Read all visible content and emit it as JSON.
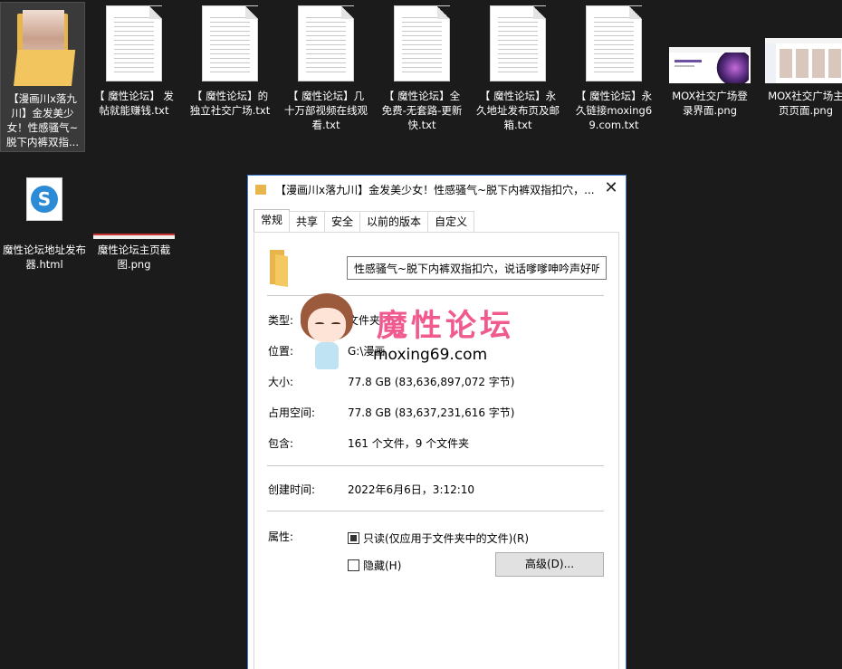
{
  "files": [
    {
      "name": "【漫画川x落九川】金发美少女！性感骚气~脱下内裤双指...",
      "type": "folder",
      "selected": true
    },
    {
      "name": "【 魔性论坛】 发帖就能赚钱.txt",
      "type": "txt"
    },
    {
      "name": "【 魔性论坛】的独立社交广场.txt",
      "type": "txt"
    },
    {
      "name": "【 魔性论坛】几十万部视频在线观看.txt",
      "type": "txt"
    },
    {
      "name": "【 魔性论坛】全免费-无套路-更新快.txt",
      "type": "txt"
    },
    {
      "name": "【 魔性论坛】永久地址发布页及邮箱.txt",
      "type": "txt"
    },
    {
      "name": "【 魔性论坛】永久链接moxing69.com.txt",
      "type": "txt"
    },
    {
      "name": "MOX社交广场登录界面.png",
      "type": "png"
    },
    {
      "name": "MOX社交广场主页页面.png",
      "type": "png"
    },
    {
      "name": "魔性论坛地址发布器.html",
      "type": "html"
    },
    {
      "name": "魔性论坛主页截图.png",
      "type": "png"
    }
  ],
  "dialog": {
    "title": "【漫画川x落九川】金发美少女！性感骚气~脱下内裤双指扣穴，...",
    "close": "✕",
    "tabs": [
      "常规",
      "共享",
      "安全",
      "以前的版本",
      "自定义"
    ],
    "name_value": "性感骚气~脱下内裤双指扣穴，说话嗲嗲呻吟声好听",
    "type_label": "类型:",
    "type_value": "文件夹",
    "location_label": "位置:",
    "location_value": "G:\\漫画",
    "size_label": "大小:",
    "size_value": "77.8 GB (83,636,897,072 字节)",
    "disk_label": "占用空间:",
    "disk_value": "77.8 GB (83,637,231,616 字节)",
    "contains_label": "包含:",
    "contains_value": "161 个文件，9 个文件夹",
    "created_label": "创建时间:",
    "created_value": "2022年6月6日，3:12:10",
    "attr_label": "属性:",
    "readonly_label": "只读(仅应用于文件夹中的文件)(R)",
    "hidden_label": "隐藏(H)",
    "advanced_label": "高级(D)..."
  },
  "watermark": {
    "title": "魔性论坛",
    "url": "moxing69.com"
  },
  "colors": {
    "desktop_bg": "#1b1b1b",
    "folder": "#e8b54a",
    "watermark_pink": "#f05a8e",
    "dialog_border": "#3d7bd6"
  }
}
